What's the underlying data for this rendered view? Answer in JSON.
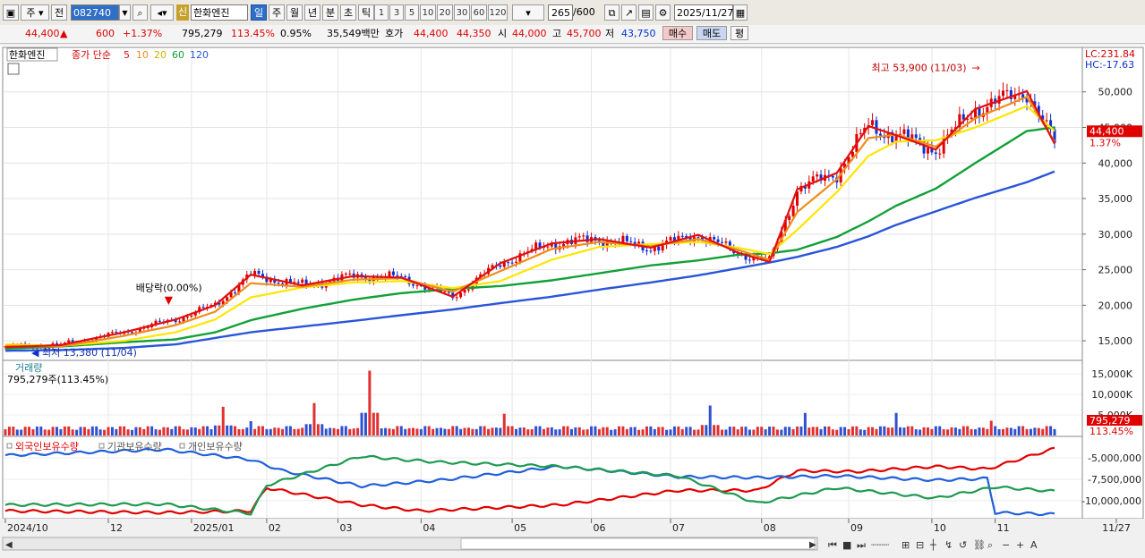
{
  "toolbar": {
    "period_main": "주",
    "period_alt": "전",
    "code": "082740",
    "shin": "신",
    "stock_name": "한화엔진",
    "periods": [
      "일",
      "주",
      "월",
      "년",
      "분",
      "초",
      "틱"
    ],
    "minute_options": [
      "1",
      "3",
      "5",
      "10",
      "20",
      "30",
      "60",
      "120"
    ],
    "count": "265",
    "count_total": "/600",
    "date": "2025/11/27"
  },
  "quote": {
    "price": "44,400",
    "change": "600",
    "change_pct": "+1.37%",
    "volume": "795,279",
    "vol_ratio": "113.45%",
    "turnover": "0.95%",
    "amount": "35,549백만",
    "bid_label": "호가",
    "ask": "44,400",
    "bid": "44,350",
    "open_label": "시",
    "open": "44,000",
    "high_label": "고",
    "high": "45,700",
    "low_label": "저",
    "low": "43,750",
    "buy_label": "매수",
    "sell_label": "매도",
    "eval_label": "평"
  },
  "chart_data": [
    {
      "type": "line",
      "title": "한화엔진",
      "legend": {
        "price_label": "종가 단순",
        "ma": [
          "5",
          "10",
          "20",
          "60",
          "120"
        ]
      },
      "colors": {
        "ma5": "#e01010",
        "ma10": "#f08c1a",
        "ma20": "#ffe500",
        "ma60": "#12a038",
        "ma120": "#2a55d8",
        "up": "#e00000",
        "down": "#1030d0"
      },
      "ylim": [
        12500,
        55500
      ],
      "y_ticks": [
        "15,000",
        "20,000",
        "25,000",
        "30,000",
        "35,000",
        "40,000",
        "45,000",
        "50,000"
      ],
      "x_ticks": [
        "2024/10",
        "12",
        "2025/01",
        "02",
        "03",
        "04",
        "05",
        "06",
        "07",
        "08",
        "09",
        "10",
        "11",
        "11/27"
      ],
      "series": [
        {
          "name": "5",
          "x": [
            0,
            14,
            30,
            43,
            53,
            62,
            75,
            88,
            100,
            113,
            125,
            138,
            150,
            163,
            175,
            185,
            193,
            200,
            210,
            218,
            225,
            235,
            245,
            258,
            265
          ],
          "values": [
            14100,
            14400,
            16200,
            18000,
            20000,
            24300,
            22800,
            24100,
            23900,
            21200,
            25900,
            28700,
            29300,
            28100,
            29900,
            27400,
            26100,
            36300,
            38600,
            45200,
            43900,
            41900,
            47600,
            50100,
            42700
          ]
        },
        {
          "name": "10",
          "x": [
            0,
            14,
            30,
            43,
            53,
            62,
            75,
            88,
            100,
            113,
            125,
            138,
            150,
            163,
            175,
            185,
            193,
            200,
            210,
            218,
            225,
            235,
            245,
            258,
            265
          ],
          "values": [
            14300,
            14200,
            15700,
            17200,
            19100,
            23100,
            22600,
            23600,
            23800,
            21900,
            24800,
            27900,
            28900,
            28300,
            29300,
            27800,
            26400,
            33100,
            37700,
            43500,
            44000,
            42300,
            46300,
            49300,
            43000
          ]
        },
        {
          "name": "20",
          "x": [
            0,
            14,
            30,
            43,
            53,
            62,
            75,
            88,
            100,
            113,
            125,
            138,
            150,
            163,
            175,
            185,
            193,
            200,
            210,
            218,
            225,
            235,
            245,
            258,
            265
          ],
          "values": [
            14500,
            14300,
            15000,
            16200,
            18000,
            21100,
            22500,
            23200,
            23400,
            22400,
            23400,
            26400,
            28200,
            28600,
            28900,
            28100,
            27200,
            30600,
            35900,
            41000,
            43000,
            43200,
            45000,
            48000,
            44500
          ]
        },
        {
          "name": "60",
          "x": [
            0,
            14,
            30,
            43,
            53,
            62,
            75,
            88,
            100,
            113,
            125,
            138,
            150,
            163,
            175,
            185,
            193,
            200,
            210,
            218,
            225,
            235,
            245,
            258,
            265
          ],
          "values": [
            13900,
            14200,
            14800,
            15200,
            16200,
            17900,
            19500,
            20800,
            21700,
            22300,
            22700,
            23500,
            24500,
            25600,
            26300,
            27100,
            27300,
            27800,
            29600,
            31800,
            34000,
            36400,
            40000,
            44500,
            45000
          ]
        },
        {
          "name": "120",
          "x": [
            0,
            14,
            30,
            43,
            53,
            62,
            75,
            88,
            100,
            113,
            125,
            138,
            150,
            163,
            175,
            185,
            193,
            200,
            210,
            218,
            225,
            235,
            245,
            258,
            265
          ],
          "values": [
            13600,
            13700,
            14000,
            14500,
            15400,
            16200,
            17000,
            17800,
            18600,
            19400,
            20300,
            21200,
            22200,
            23200,
            24200,
            25200,
            26000,
            26800,
            28200,
            29700,
            31300,
            33200,
            35100,
            37300,
            38800
          ]
        }
      ],
      "annotations": [
        {
          "text": "최고 53,900 (11/03)",
          "x": 245,
          "y": 53900
        },
        {
          "text": "최저 13,380 (11/04)",
          "x": 7,
          "y": 13380
        },
        {
          "text": "배당락(0.00%)",
          "x": 42,
          "y": 19200
        }
      ],
      "right_labels": {
        "lc": "LC:231.84",
        "hc": "HC:-17.63",
        "price": "44,400",
        "change_pct": "1.37%"
      }
    },
    {
      "type": "bar",
      "title": "거래량",
      "value_label": "795,279주(113.45%)",
      "ylim": [
        0,
        17000
      ],
      "y_ticks": [
        "5,000K",
        "10,000K",
        "15,000K"
      ],
      "right_labels": {
        "value": "795,279",
        "ratio": "113.45%"
      },
      "peaks": [
        {
          "x": 55,
          "value": 7000
        },
        {
          "x": 62,
          "value": 3500
        },
        {
          "x": 78,
          "value": 7900
        },
        {
          "x": 92,
          "value": 15800
        },
        {
          "x": 126,
          "value": 5300
        },
        {
          "x": 178,
          "value": 7300
        },
        {
          "x": 202,
          "value": 5500
        },
        {
          "x": 225,
          "value": 5500
        },
        {
          "x": 249,
          "value": 3600
        }
      ]
    },
    {
      "type": "line",
      "title": "외국인보유수량 / 기관보유수량 / 개인보유수량",
      "series_labels": [
        "외국인보유수량",
        "기관보유수량",
        "개인보유수량"
      ],
      "colors": {
        "foreign": "#e00000",
        "inst": "#2060d8",
        "retail": "#1e9a50"
      },
      "ylim": [
        -12000000,
        -3000000
      ],
      "y_ticks": [
        "-5,000,000",
        "-7,500,000",
        "-10,000,000"
      ]
    }
  ]
}
